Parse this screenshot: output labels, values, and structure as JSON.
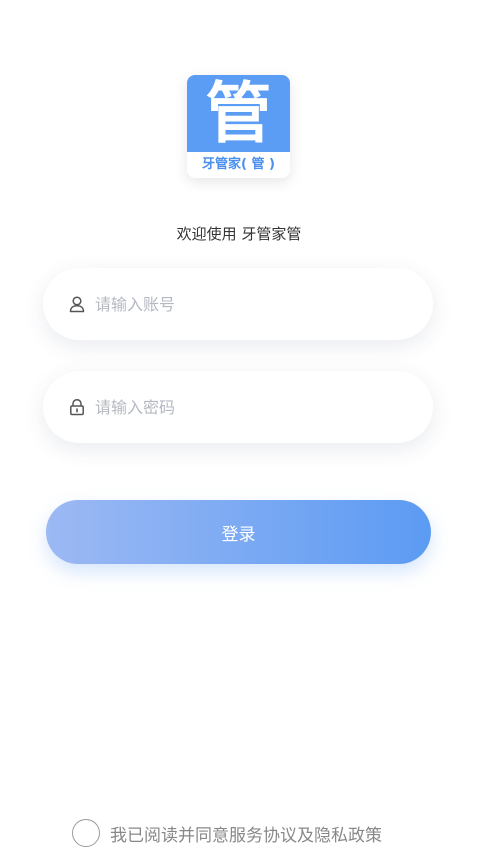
{
  "app": {
    "logo_glyph": "管",
    "logo_caption": "牙管家( 管 )",
    "welcome_text": "欢迎使用 牙管家管",
    "brand_color": "#5b9cf4"
  },
  "form": {
    "account": {
      "placeholder": "请输入账号",
      "icon": "user-icon"
    },
    "password": {
      "placeholder": "请输入密码",
      "icon": "lock-icon"
    },
    "login_label": "登录"
  },
  "agreement": {
    "checked": false,
    "text": "我已阅读并同意服务协议及隐私政策"
  }
}
